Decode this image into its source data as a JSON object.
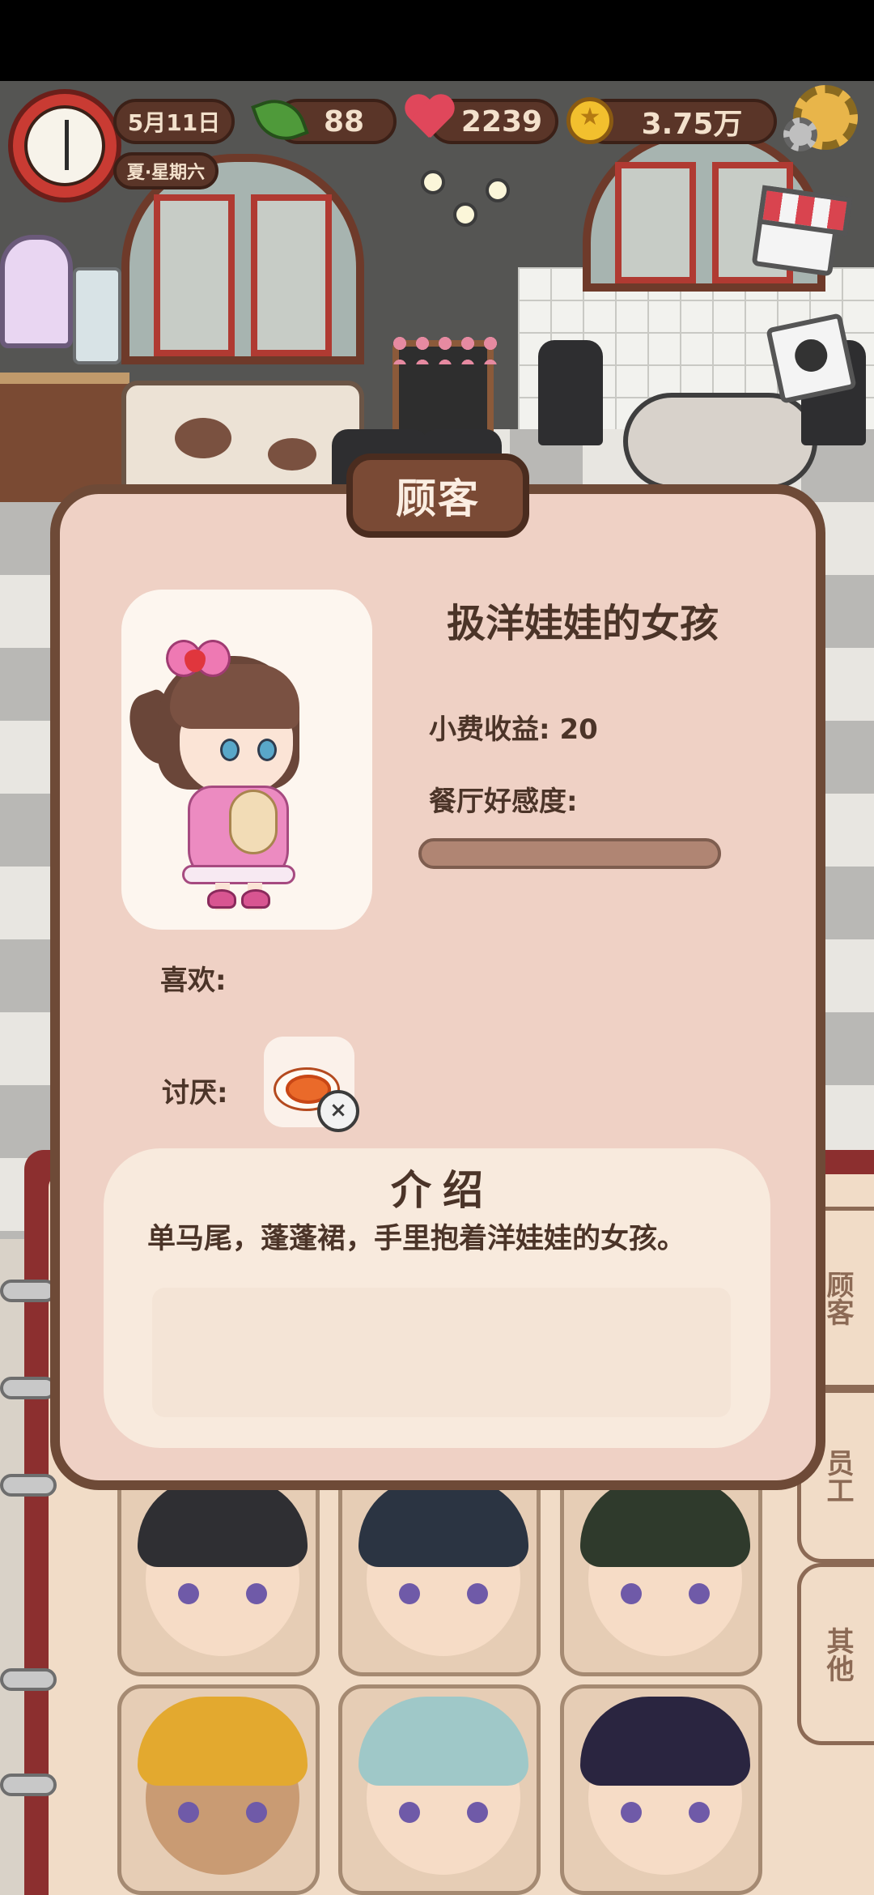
{
  "hud": {
    "date": "5月11日",
    "season_weekday": "夏·星期六",
    "leaves": "88",
    "hearts": "2239",
    "coins": "3.75万"
  },
  "modal": {
    "title": "顾客",
    "character_name": "扱洋娃娃的女孩",
    "tip_label": "小费收益:",
    "tip_value": "20",
    "favor_label": "餐厅好感度:",
    "favor_fraction": 0,
    "likes_label": "喜欢:",
    "dislikes_label": "讨厌:",
    "intro_title": "介绍",
    "intro_text": "单马尾，蓬蓬裙，手里抱着洋娃娃的女孩。"
  },
  "side_tabs": [
    {
      "label": "顾客"
    },
    {
      "label": "员工"
    },
    {
      "label": "其他"
    }
  ],
  "icons": {
    "clock": "clock-icon",
    "leaf": "leaf-icon",
    "heart": "heart-icon",
    "coin": "coin-icon",
    "settings": "gear-icon",
    "shop": "shop-icon",
    "album": "photo-icon",
    "dislike": "annoyed-face-icon"
  },
  "colors": {
    "modal_bg": "#efd1c5",
    "modal_border": "#6e4a37",
    "title_tab": "#7a4a35",
    "text": "#4b3428"
  }
}
